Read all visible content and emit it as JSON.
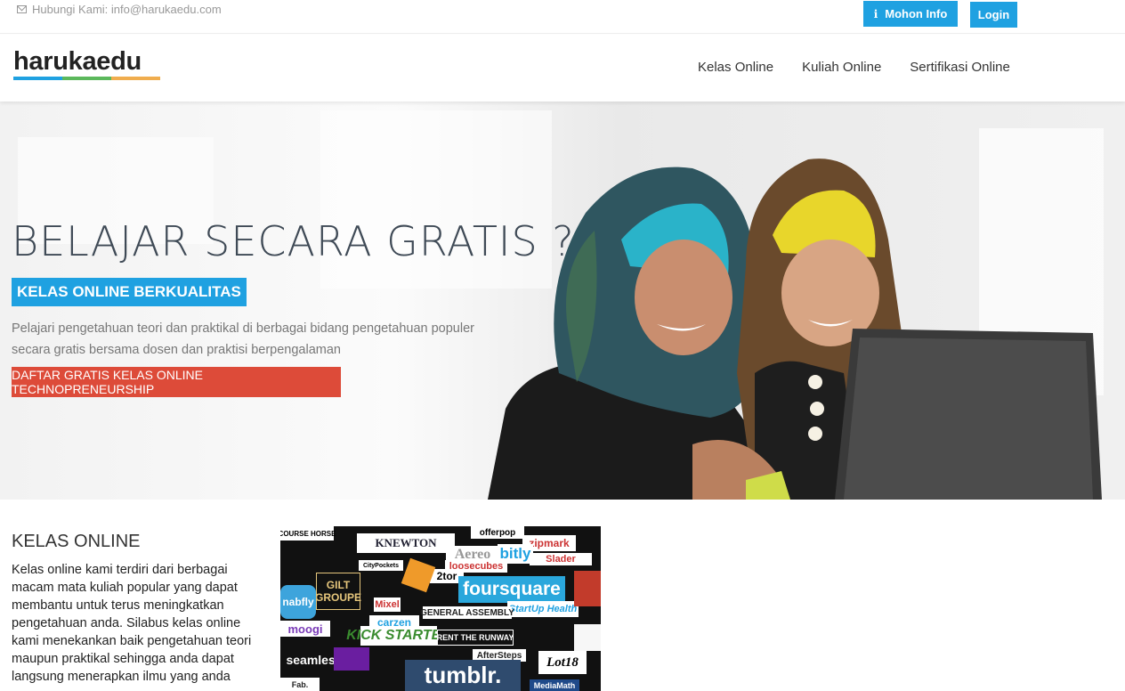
{
  "topbar": {
    "contact": "Hubungi Kami: info@harukaedu.com",
    "info_button": "Mohon Info",
    "login_button": "Login"
  },
  "nav": {
    "logo": "harukaedu",
    "links": [
      "Kelas Online",
      "Kuliah Online",
      "Sertifikasi Online"
    ]
  },
  "hero": {
    "title": "BELAJAR SECARA GRATIS ?",
    "badge": "KELAS ONLINE BERKUALITAS",
    "text": "Pelajari pengetahuan teori dan praktikal di berbagai bidang pengetahuan populer secara gratis bersama dosen dan praktisi berpengalaman",
    "cta": "DAFTAR GRATIS KELAS ONLINE TECHNOPRENEURSHIP"
  },
  "section": {
    "title": "KELAS ONLINE",
    "text": "Kelas online kami terdiri dari berbagai macam mata kuliah popular yang dapat membantu untuk terus meningkatkan pengetahuan anda. Silabus kelas online kami menekankan baik pengetahuan teori maupun praktikal sehingga anda dapat langsung menerapkan ilmu yang anda"
  },
  "collage": {
    "logos": [
      "foursquare",
      "tumblr.",
      "KNEWTON",
      "GILT GROUPE",
      "bitly",
      "seamless",
      "KICK STARTER",
      "zipmark",
      "GENERAL ASSEMBLY",
      "StartUp Health",
      "offerpop",
      "Aereo",
      "loosecubes",
      "2tor",
      "RENT THE RUNWAY",
      "AfterSteps",
      "nabfly",
      "moogi",
      "carzen",
      "Lot18",
      "MediaMath",
      "COURSE HORSE",
      "CityPockets",
      "Slader",
      "Mixel",
      "Fab."
    ]
  },
  "colors": {
    "accent_blue": "#1fa1e1",
    "cta_red": "#dd4b39",
    "logo_bar": [
      "#1fa1e1",
      "#5cb85c",
      "#f0ad4e"
    ]
  }
}
